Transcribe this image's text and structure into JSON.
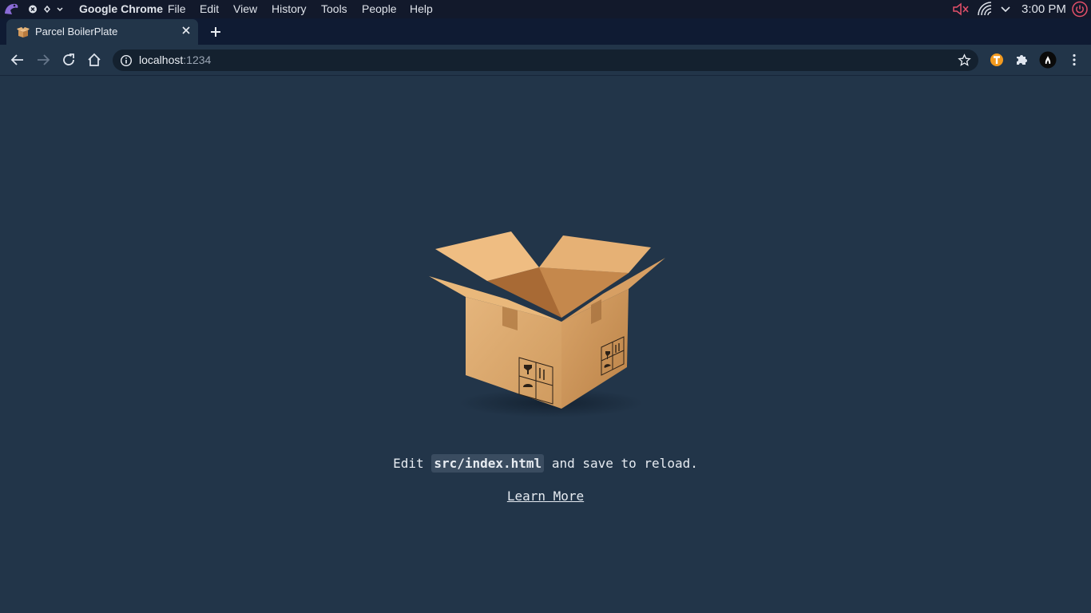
{
  "os_bar": {
    "app_name": "Google Chrome",
    "menus": [
      "File",
      "Edit",
      "View",
      "History",
      "Tools",
      "People",
      "Help"
    ],
    "clock": "3:00 PM",
    "icons": [
      "launcher-logo-icon",
      "close-circle-icon",
      "diamond-icon",
      "chevron-down-icon",
      "volume-muted-icon",
      "wifi-icon",
      "chevron-down-icon",
      "power-icon"
    ],
    "colors": {
      "background": "#12192b",
      "volume": "#e4506a",
      "power": "#e4506a"
    }
  },
  "tab": {
    "title": "Parcel BoilerPlate",
    "favicon": "parcel-box-icon"
  },
  "toolbar": {
    "url_host": "localhost",
    "url_port": ":1234",
    "icons": [
      "back-arrow-icon",
      "forward-arrow-icon",
      "reload-icon",
      "home-icon",
      "info-icon",
      "star-icon",
      "extension-t-icon",
      "puzzle-icon",
      "profile-avatar-icon",
      "kebab-menu-icon"
    ]
  },
  "page": {
    "edit_prefix": "Edit ",
    "edit_file": "src/index.html",
    "edit_suffix": " and save to reload.",
    "learn_more": "Learn More",
    "hero_image": "cardboard-box",
    "colors": {
      "background": "#223549",
      "text": "#e6ebf1",
      "box": "#d9a66b"
    }
  }
}
